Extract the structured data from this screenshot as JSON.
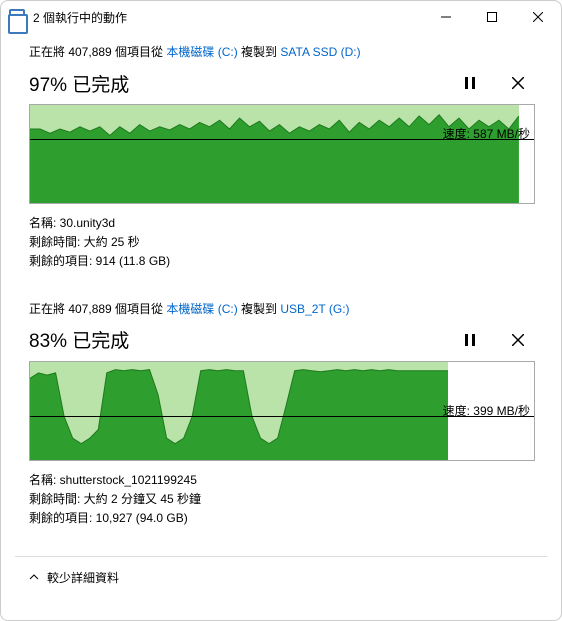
{
  "title": "2 個執行中的動作",
  "footer_label": "較少詳細資料",
  "operations": [
    {
      "src_prefix": "正在將 407,889 個項目從 ",
      "src_link": "本機磁碟 (C:)",
      "src_mid": " 複製到 ",
      "dst_link": "SATA SSD (D:)",
      "pct_text": "97% 已完成",
      "speed_label": "速度: 587 MB/秒",
      "name_line": "名稱: 30.unity3d",
      "time_line": "剩餘時間: 大約 25 秒",
      "items_line": "剩餘的項目: 914 (11.8 GB)"
    },
    {
      "src_prefix": "正在將 407,889 個項目從 ",
      "src_link": "本機磁碟 (C:)",
      "src_mid": " 複製到 ",
      "dst_link": "USB_2T (G:)",
      "pct_text": "83% 已完成",
      "speed_label": "速度: 399 MB/秒",
      "name_line": "名稱: shutterstock_1021199245",
      "time_line": "剩餘時間: 大約 2 分鐘又 45 秒鐘",
      "items_line": "剩餘的項目: 10,927 (94.0 GB)"
    }
  ],
  "chart_data": [
    {
      "type": "area",
      "xlabel": "",
      "ylabel": "MB/秒",
      "ylim": [
        0,
        900
      ],
      "current_speed": 587,
      "fill_fraction": 0.97,
      "values": [
        680,
        680,
        640,
        680,
        650,
        700,
        660,
        700,
        620,
        700,
        640,
        720,
        660,
        700,
        670,
        720,
        680,
        740,
        700,
        760,
        680,
        780,
        700,
        750,
        660,
        720,
        640,
        700,
        660,
        720,
        680,
        760,
        650,
        740,
        680,
        760,
        700,
        780,
        700,
        800,
        720,
        810,
        700,
        780,
        680,
        760,
        700,
        760,
        680,
        800
      ]
    },
    {
      "type": "area",
      "xlabel": "",
      "ylabel": "MB/秒",
      "ylim": [
        0,
        900
      ],
      "current_speed": 399,
      "fill_fraction": 0.83,
      "values": [
        750,
        800,
        780,
        800,
        400,
        200,
        150,
        200,
        280,
        800,
        830,
        820,
        830,
        820,
        830,
        600,
        200,
        150,
        200,
        400,
        820,
        830,
        820,
        830,
        820,
        820,
        400,
        200,
        150,
        200,
        500,
        820,
        830,
        820,
        810,
        820,
        830,
        820,
        830,
        820,
        830,
        820,
        830,
        820,
        820,
        820,
        820,
        820,
        820,
        820
      ]
    }
  ]
}
